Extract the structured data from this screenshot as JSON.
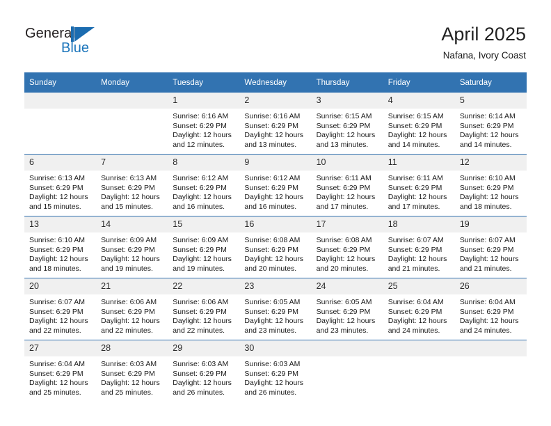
{
  "logo": {
    "word_one": "General",
    "word_two": "Blue",
    "mark": "flag-triangle"
  },
  "header": {
    "month_title": "April 2025",
    "location": "Nafana, Ivory Coast"
  },
  "colors": {
    "header_blue": "#3273b1",
    "row_divider": "#2f6fae",
    "daynum_band": "#f0f0f0",
    "logo_blue": "#1b75bb"
  },
  "calendar": {
    "weekday_headers": [
      "Sunday",
      "Monday",
      "Tuesday",
      "Wednesday",
      "Thursday",
      "Friday",
      "Saturday"
    ],
    "weeks": [
      [
        {
          "day": "",
          "lines": []
        },
        {
          "day": "",
          "lines": []
        },
        {
          "day": "1",
          "lines": [
            "Sunrise: 6:16 AM",
            "Sunset: 6:29 PM",
            "Daylight: 12 hours",
            "and 12 minutes."
          ]
        },
        {
          "day": "2",
          "lines": [
            "Sunrise: 6:16 AM",
            "Sunset: 6:29 PM",
            "Daylight: 12 hours",
            "and 13 minutes."
          ]
        },
        {
          "day": "3",
          "lines": [
            "Sunrise: 6:15 AM",
            "Sunset: 6:29 PM",
            "Daylight: 12 hours",
            "and 13 minutes."
          ]
        },
        {
          "day": "4",
          "lines": [
            "Sunrise: 6:15 AM",
            "Sunset: 6:29 PM",
            "Daylight: 12 hours",
            "and 14 minutes."
          ]
        },
        {
          "day": "5",
          "lines": [
            "Sunrise: 6:14 AM",
            "Sunset: 6:29 PM",
            "Daylight: 12 hours",
            "and 14 minutes."
          ]
        }
      ],
      [
        {
          "day": "6",
          "lines": [
            "Sunrise: 6:13 AM",
            "Sunset: 6:29 PM",
            "Daylight: 12 hours",
            "and 15 minutes."
          ]
        },
        {
          "day": "7",
          "lines": [
            "Sunrise: 6:13 AM",
            "Sunset: 6:29 PM",
            "Daylight: 12 hours",
            "and 15 minutes."
          ]
        },
        {
          "day": "8",
          "lines": [
            "Sunrise: 6:12 AM",
            "Sunset: 6:29 PM",
            "Daylight: 12 hours",
            "and 16 minutes."
          ]
        },
        {
          "day": "9",
          "lines": [
            "Sunrise: 6:12 AM",
            "Sunset: 6:29 PM",
            "Daylight: 12 hours",
            "and 16 minutes."
          ]
        },
        {
          "day": "10",
          "lines": [
            "Sunrise: 6:11 AM",
            "Sunset: 6:29 PM",
            "Daylight: 12 hours",
            "and 17 minutes."
          ]
        },
        {
          "day": "11",
          "lines": [
            "Sunrise: 6:11 AM",
            "Sunset: 6:29 PM",
            "Daylight: 12 hours",
            "and 17 minutes."
          ]
        },
        {
          "day": "12",
          "lines": [
            "Sunrise: 6:10 AM",
            "Sunset: 6:29 PM",
            "Daylight: 12 hours",
            "and 18 minutes."
          ]
        }
      ],
      [
        {
          "day": "13",
          "lines": [
            "Sunrise: 6:10 AM",
            "Sunset: 6:29 PM",
            "Daylight: 12 hours",
            "and 18 minutes."
          ]
        },
        {
          "day": "14",
          "lines": [
            "Sunrise: 6:09 AM",
            "Sunset: 6:29 PM",
            "Daylight: 12 hours",
            "and 19 minutes."
          ]
        },
        {
          "day": "15",
          "lines": [
            "Sunrise: 6:09 AM",
            "Sunset: 6:29 PM",
            "Daylight: 12 hours",
            "and 19 minutes."
          ]
        },
        {
          "day": "16",
          "lines": [
            "Sunrise: 6:08 AM",
            "Sunset: 6:29 PM",
            "Daylight: 12 hours",
            "and 20 minutes."
          ]
        },
        {
          "day": "17",
          "lines": [
            "Sunrise: 6:08 AM",
            "Sunset: 6:29 PM",
            "Daylight: 12 hours",
            "and 20 minutes."
          ]
        },
        {
          "day": "18",
          "lines": [
            "Sunrise: 6:07 AM",
            "Sunset: 6:29 PM",
            "Daylight: 12 hours",
            "and 21 minutes."
          ]
        },
        {
          "day": "19",
          "lines": [
            "Sunrise: 6:07 AM",
            "Sunset: 6:29 PM",
            "Daylight: 12 hours",
            "and 21 minutes."
          ]
        }
      ],
      [
        {
          "day": "20",
          "lines": [
            "Sunrise: 6:07 AM",
            "Sunset: 6:29 PM",
            "Daylight: 12 hours",
            "and 22 minutes."
          ]
        },
        {
          "day": "21",
          "lines": [
            "Sunrise: 6:06 AM",
            "Sunset: 6:29 PM",
            "Daylight: 12 hours",
            "and 22 minutes."
          ]
        },
        {
          "day": "22",
          "lines": [
            "Sunrise: 6:06 AM",
            "Sunset: 6:29 PM",
            "Daylight: 12 hours",
            "and 22 minutes."
          ]
        },
        {
          "day": "23",
          "lines": [
            "Sunrise: 6:05 AM",
            "Sunset: 6:29 PM",
            "Daylight: 12 hours",
            "and 23 minutes."
          ]
        },
        {
          "day": "24",
          "lines": [
            "Sunrise: 6:05 AM",
            "Sunset: 6:29 PM",
            "Daylight: 12 hours",
            "and 23 minutes."
          ]
        },
        {
          "day": "25",
          "lines": [
            "Sunrise: 6:04 AM",
            "Sunset: 6:29 PM",
            "Daylight: 12 hours",
            "and 24 minutes."
          ]
        },
        {
          "day": "26",
          "lines": [
            "Sunrise: 6:04 AM",
            "Sunset: 6:29 PM",
            "Daylight: 12 hours",
            "and 24 minutes."
          ]
        }
      ],
      [
        {
          "day": "27",
          "lines": [
            "Sunrise: 6:04 AM",
            "Sunset: 6:29 PM",
            "Daylight: 12 hours",
            "and 25 minutes."
          ]
        },
        {
          "day": "28",
          "lines": [
            "Sunrise: 6:03 AM",
            "Sunset: 6:29 PM",
            "Daylight: 12 hours",
            "and 25 minutes."
          ]
        },
        {
          "day": "29",
          "lines": [
            "Sunrise: 6:03 AM",
            "Sunset: 6:29 PM",
            "Daylight: 12 hours",
            "and 26 minutes."
          ]
        },
        {
          "day": "30",
          "lines": [
            "Sunrise: 6:03 AM",
            "Sunset: 6:29 PM",
            "Daylight: 12 hours",
            "and 26 minutes."
          ]
        },
        {
          "day": "",
          "lines": []
        },
        {
          "day": "",
          "lines": []
        },
        {
          "day": "",
          "lines": []
        }
      ]
    ]
  }
}
